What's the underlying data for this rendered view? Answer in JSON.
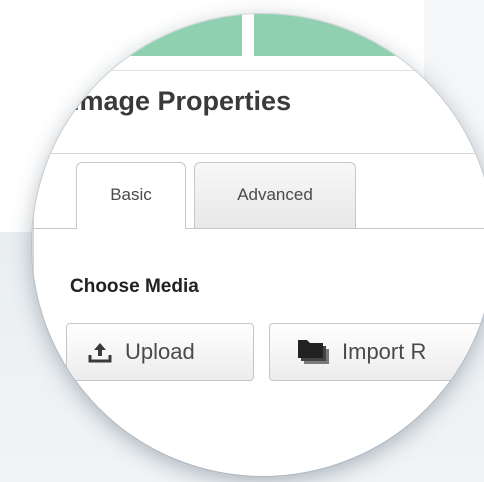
{
  "dialog": {
    "title": "Image Properties",
    "tabs": [
      {
        "label": "Basic",
        "active": true
      },
      {
        "label": "Advanced",
        "active": false
      }
    ],
    "section_label": "Choose Media",
    "buttons": {
      "upload": {
        "label": "Upload",
        "icon": "upload-icon"
      },
      "import": {
        "label": "Import R",
        "icon": "folder-icon"
      }
    }
  },
  "colors": {
    "accent_green": "#8fd0b0",
    "title_text": "#3a3a3a",
    "button_text": "#4a4a4a"
  }
}
